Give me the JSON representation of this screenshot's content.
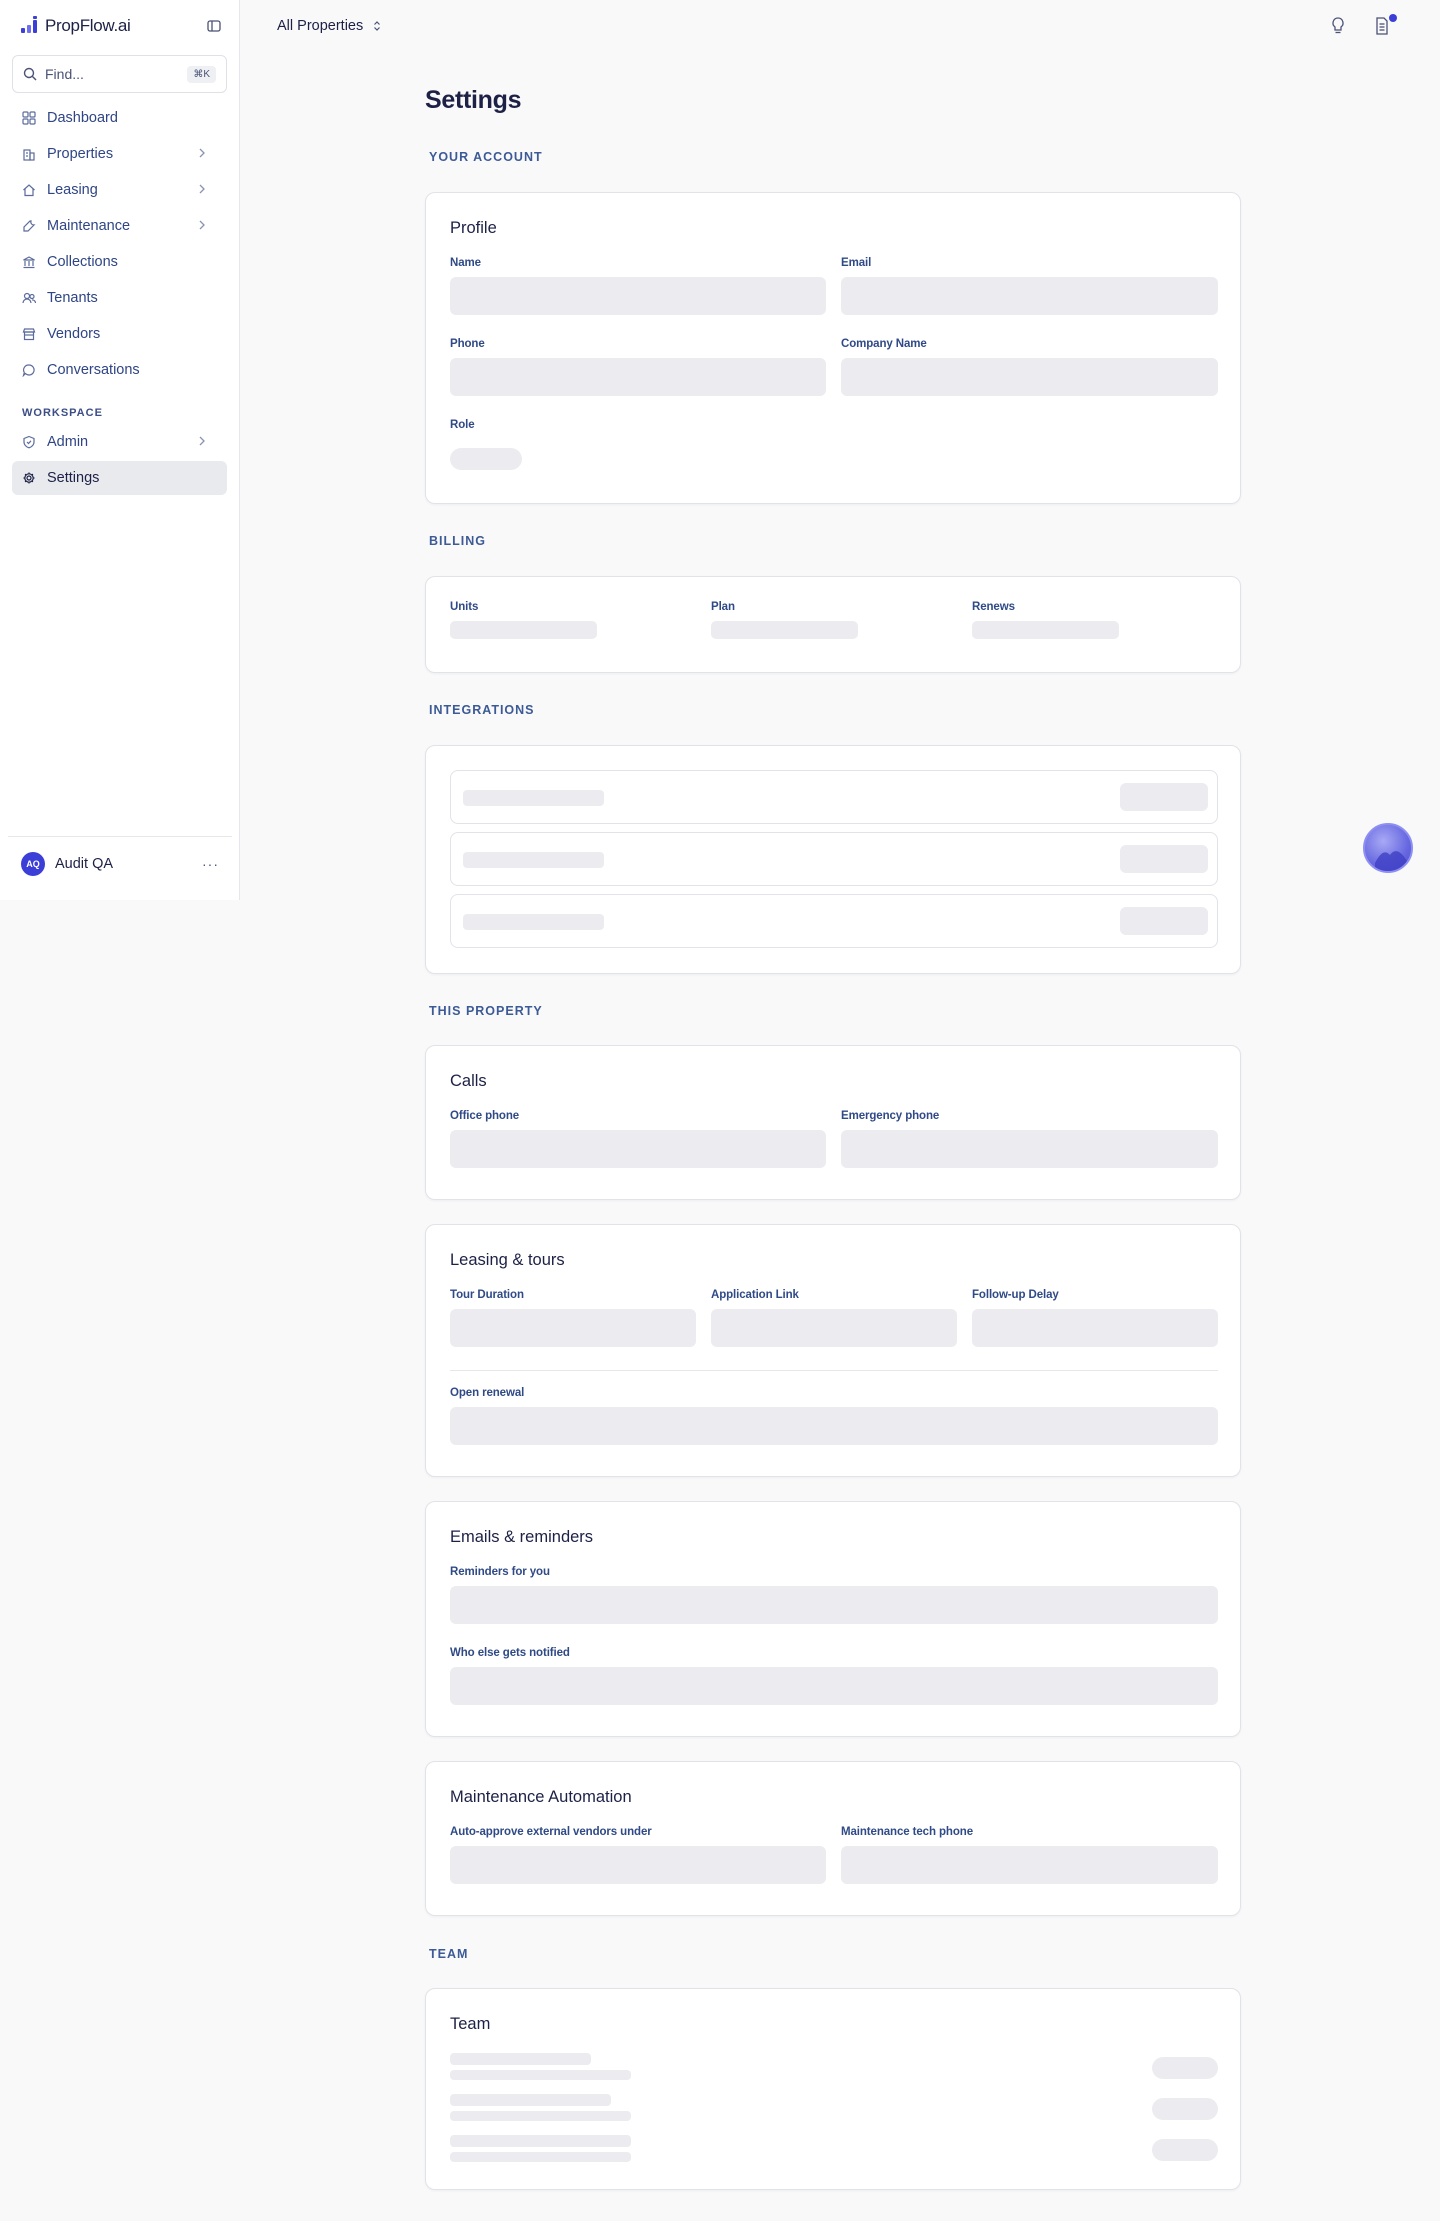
{
  "app": {
    "name": "PropFlow.ai",
    "search_placeholder": "Find...",
    "search_shortcut": "⌘K"
  },
  "sidebar": {
    "items": [
      {
        "label": "Dashboard",
        "icon": "grid-icon",
        "has_chevron": false
      },
      {
        "label": "Properties",
        "icon": "building-icon",
        "has_chevron": true
      },
      {
        "label": "Leasing",
        "icon": "home-icon",
        "has_chevron": true
      },
      {
        "label": "Maintenance",
        "icon": "wrench-icon",
        "has_chevron": true
      },
      {
        "label": "Collections",
        "icon": "bank-icon",
        "has_chevron": false
      },
      {
        "label": "Tenants",
        "icon": "users-icon",
        "has_chevron": false
      },
      {
        "label": "Vendors",
        "icon": "store-icon",
        "has_chevron": false
      },
      {
        "label": "Conversations",
        "icon": "chat-icon",
        "has_chevron": false
      }
    ],
    "workspace_label": "WORKSPACE",
    "workspace_items": [
      {
        "label": "Admin",
        "icon": "shield-icon",
        "has_chevron": true
      },
      {
        "label": "Settings",
        "icon": "gear-icon",
        "has_chevron": false,
        "active": true
      }
    ],
    "user": {
      "initials": "AQ",
      "name": "Audit QA",
      "menu": "···"
    }
  },
  "topbar": {
    "property_selector": "All Properties",
    "icons": [
      "lightbulb-icon",
      "document-icon"
    ]
  },
  "page": {
    "title": "Settings",
    "sections": {
      "account": "YOUR ACCOUNT",
      "billing": "BILLING",
      "integrations": "INTEGRATIONS",
      "property": "THIS PROPERTY",
      "team": "TEAM"
    },
    "profile": {
      "title": "Profile",
      "name": "Name",
      "email": "Email",
      "phone": "Phone",
      "company": "Company Name",
      "role": "Role"
    },
    "billing": {
      "units": "Units",
      "plan": "Plan",
      "renews": "Renews"
    },
    "calls": {
      "title": "Calls",
      "office_phone": "Office phone",
      "emergency_phone": "Emergency phone"
    },
    "leasing": {
      "title": "Leasing & tours",
      "tour_duration": "Tour Duration",
      "application_link": "Application Link",
      "followup_delay": "Follow-up Delay",
      "open_renewal": "Open renewal"
    },
    "emails": {
      "title": "Emails & reminders",
      "reminders": "Reminders for you",
      "notified": "Who else gets notified"
    },
    "maintenance": {
      "title": "Maintenance Automation",
      "auto_approve": "Auto-approve external vendors under",
      "tech_phone": "Maintenance tech phone"
    },
    "team": {
      "title": "Team"
    }
  },
  "colors": {
    "accent": "#3b3fd8",
    "skeleton": "#ececf0",
    "label": "#2f4a86"
  }
}
